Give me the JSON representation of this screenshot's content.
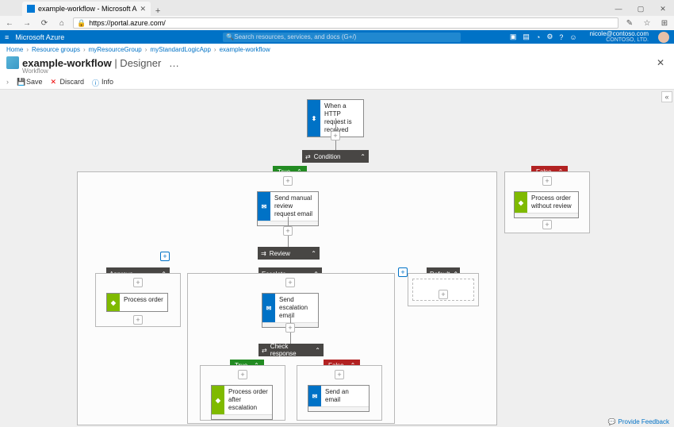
{
  "browser": {
    "tab_title": "example-workflow - Microsoft A",
    "url": "https://portal.azure.com/"
  },
  "azure": {
    "brand": "Microsoft Azure",
    "search_placeholder": "Search resources, services, and docs (G+/)",
    "user_email": "nicole@contoso.com",
    "user_org": "CONTOSO, LTD."
  },
  "breadcrumb": {
    "items": [
      "Home",
      "Resource groups",
      "myResourceGroup",
      "myStandardLogicApp",
      "example-workflow"
    ]
  },
  "page": {
    "title_main": "example-workflow",
    "title_suffix": " | Designer",
    "ellipsis": "…",
    "subtitle": "Workflow"
  },
  "toolbar": {
    "save": "Save",
    "discard": "Discard",
    "info": "Info"
  },
  "flow": {
    "trigger": "When a HTTP request is received",
    "condition": "Condition",
    "true": "True",
    "false": "False",
    "send_manual": "Send manual review request email",
    "process_without": "Process order without review",
    "review": "Review",
    "approve": "Approve",
    "escalate": "Escalate",
    "default": "Default",
    "process_order": "Process order",
    "send_escalation": "Send escalation email",
    "check_response": "Check response",
    "nested_true": "True",
    "nested_false": "False",
    "process_after": "Process order after escalation",
    "send_email": "Send an email"
  },
  "footer": {
    "feedback": "Provide Feedback"
  }
}
